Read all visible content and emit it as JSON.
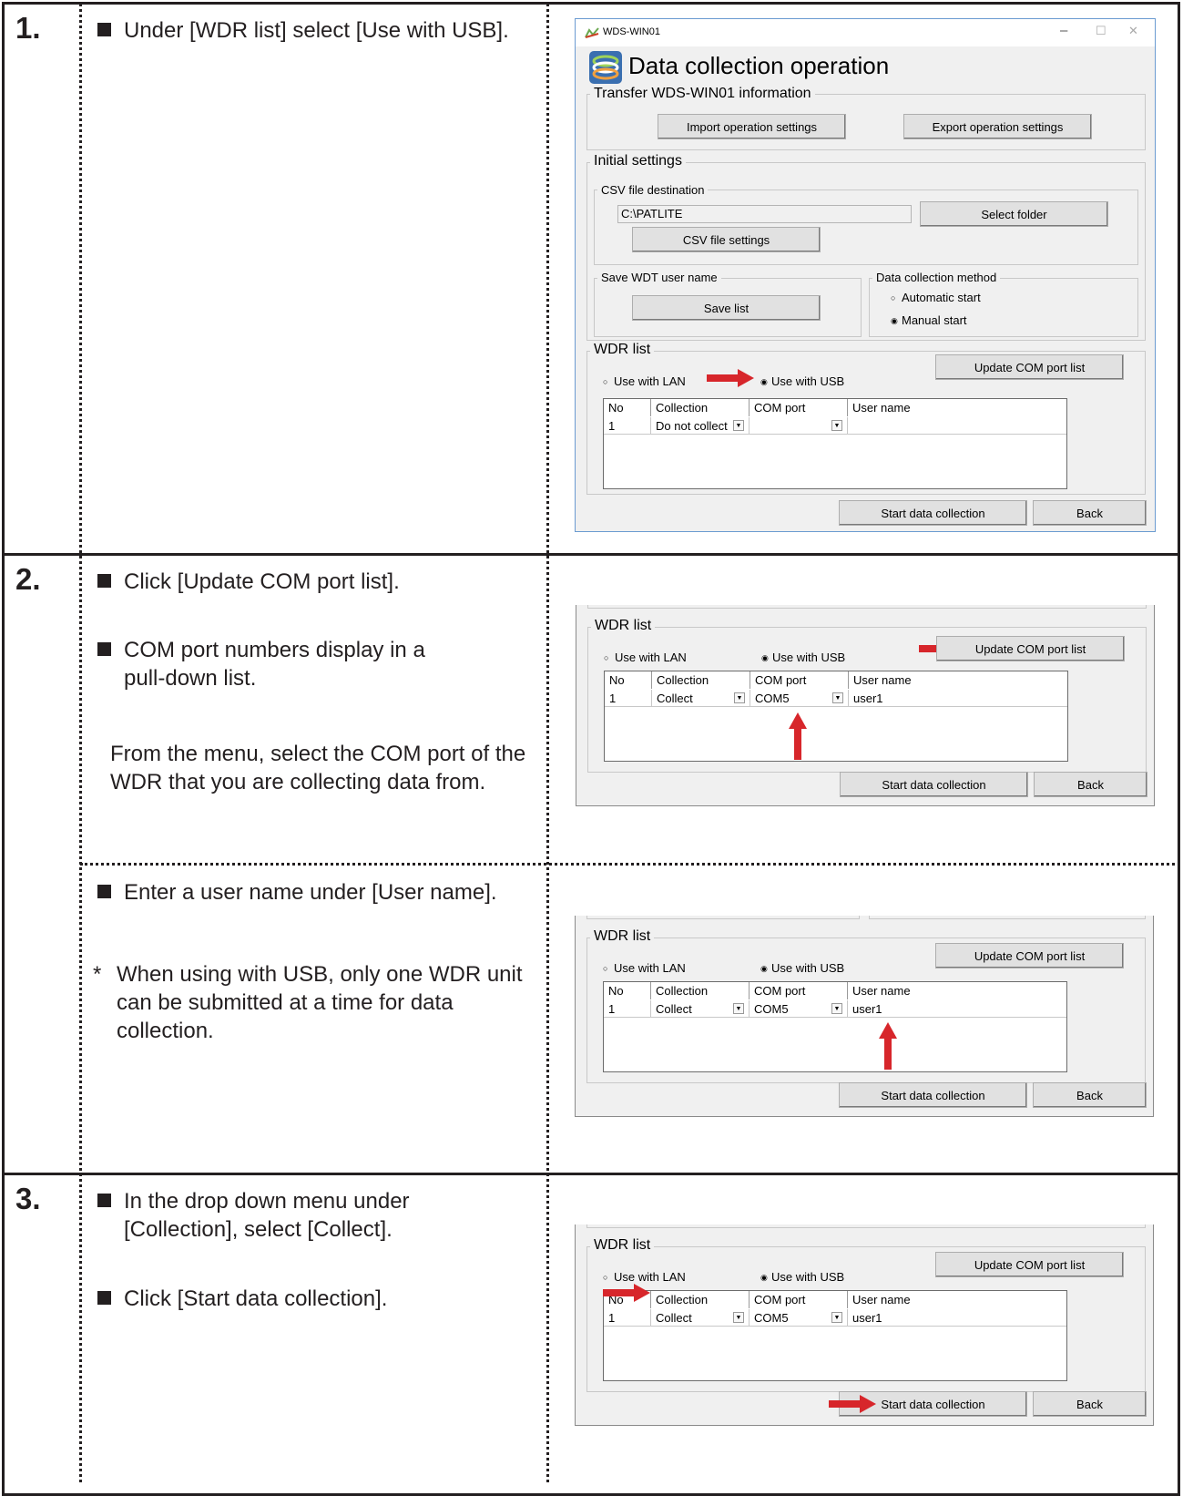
{
  "steps": [
    {
      "number": "1.",
      "items": [
        "Under [WDR list] select [Use with USB]."
      ]
    },
    {
      "number": "2.",
      "items": [
        "Click [Update COM port list].",
        "COM port numbers display in a pull-down list."
      ],
      "note": "From the menu, select the COM port of the WDR that you are collecting data from.",
      "sub_item": "Enter a user name under [User name].",
      "asterisk": "*",
      "footnote": "When using with USB, only one WDR unit can be submitted at a time for data collection."
    },
    {
      "number": "3.",
      "items": [
        "In the drop down menu under [Collection], select [Collect].",
        "Click [Start data collection]."
      ]
    }
  ],
  "dialog": {
    "window_title": "WDS-WIN01",
    "minimize": "–",
    "maximize": "☐",
    "close": "✕",
    "heading": "Data collection operation",
    "transfer_group": "Transfer WDS-WIN01 information",
    "import_button": "Import operation settings",
    "export_button": "Export operation settings",
    "initial_group": "Initial settings",
    "csv_group": "CSV file destination",
    "csv_path": "C:\\PATLITE",
    "select_folder_button": "Select folder",
    "csv_settings_button": "CSV file settings",
    "save_wdt_group": "Save WDT user name",
    "save_list_button": "Save list",
    "method_group": "Data collection method",
    "automatic_start": "Automatic start",
    "manual_start": "Manual start",
    "radio_off": "○",
    "radio_on": "◉",
    "wdr_group": "WDR list",
    "use_lan": "Use with LAN",
    "use_usb": "Use with USB",
    "update_com_button": "Update COM port list",
    "columns": [
      "No",
      "Collection",
      "COM port",
      "User name"
    ],
    "start_button": "Start data collection",
    "back_button": "Back",
    "dropdown_glyph": "▼"
  },
  "grid_rows": {
    "step1": {
      "no": "1",
      "collection": "Do not collect",
      "com_port": "",
      "user_name": ""
    },
    "step2": {
      "no": "1",
      "collection": "Collect",
      "com_port": "COM5",
      "user_name": "user1"
    },
    "step2b": {
      "no": "1",
      "collection": "Collect",
      "com_port": "COM5",
      "user_name": "user1"
    },
    "step3": {
      "no": "1",
      "collection": "Collect",
      "com_port": "COM5",
      "user_name": "user1"
    }
  },
  "colors": {
    "arrow": "#d7262b",
    "line": "#231f20",
    "dialog_bg": "#f0f0f0",
    "window_border": "#6b9bd1"
  }
}
